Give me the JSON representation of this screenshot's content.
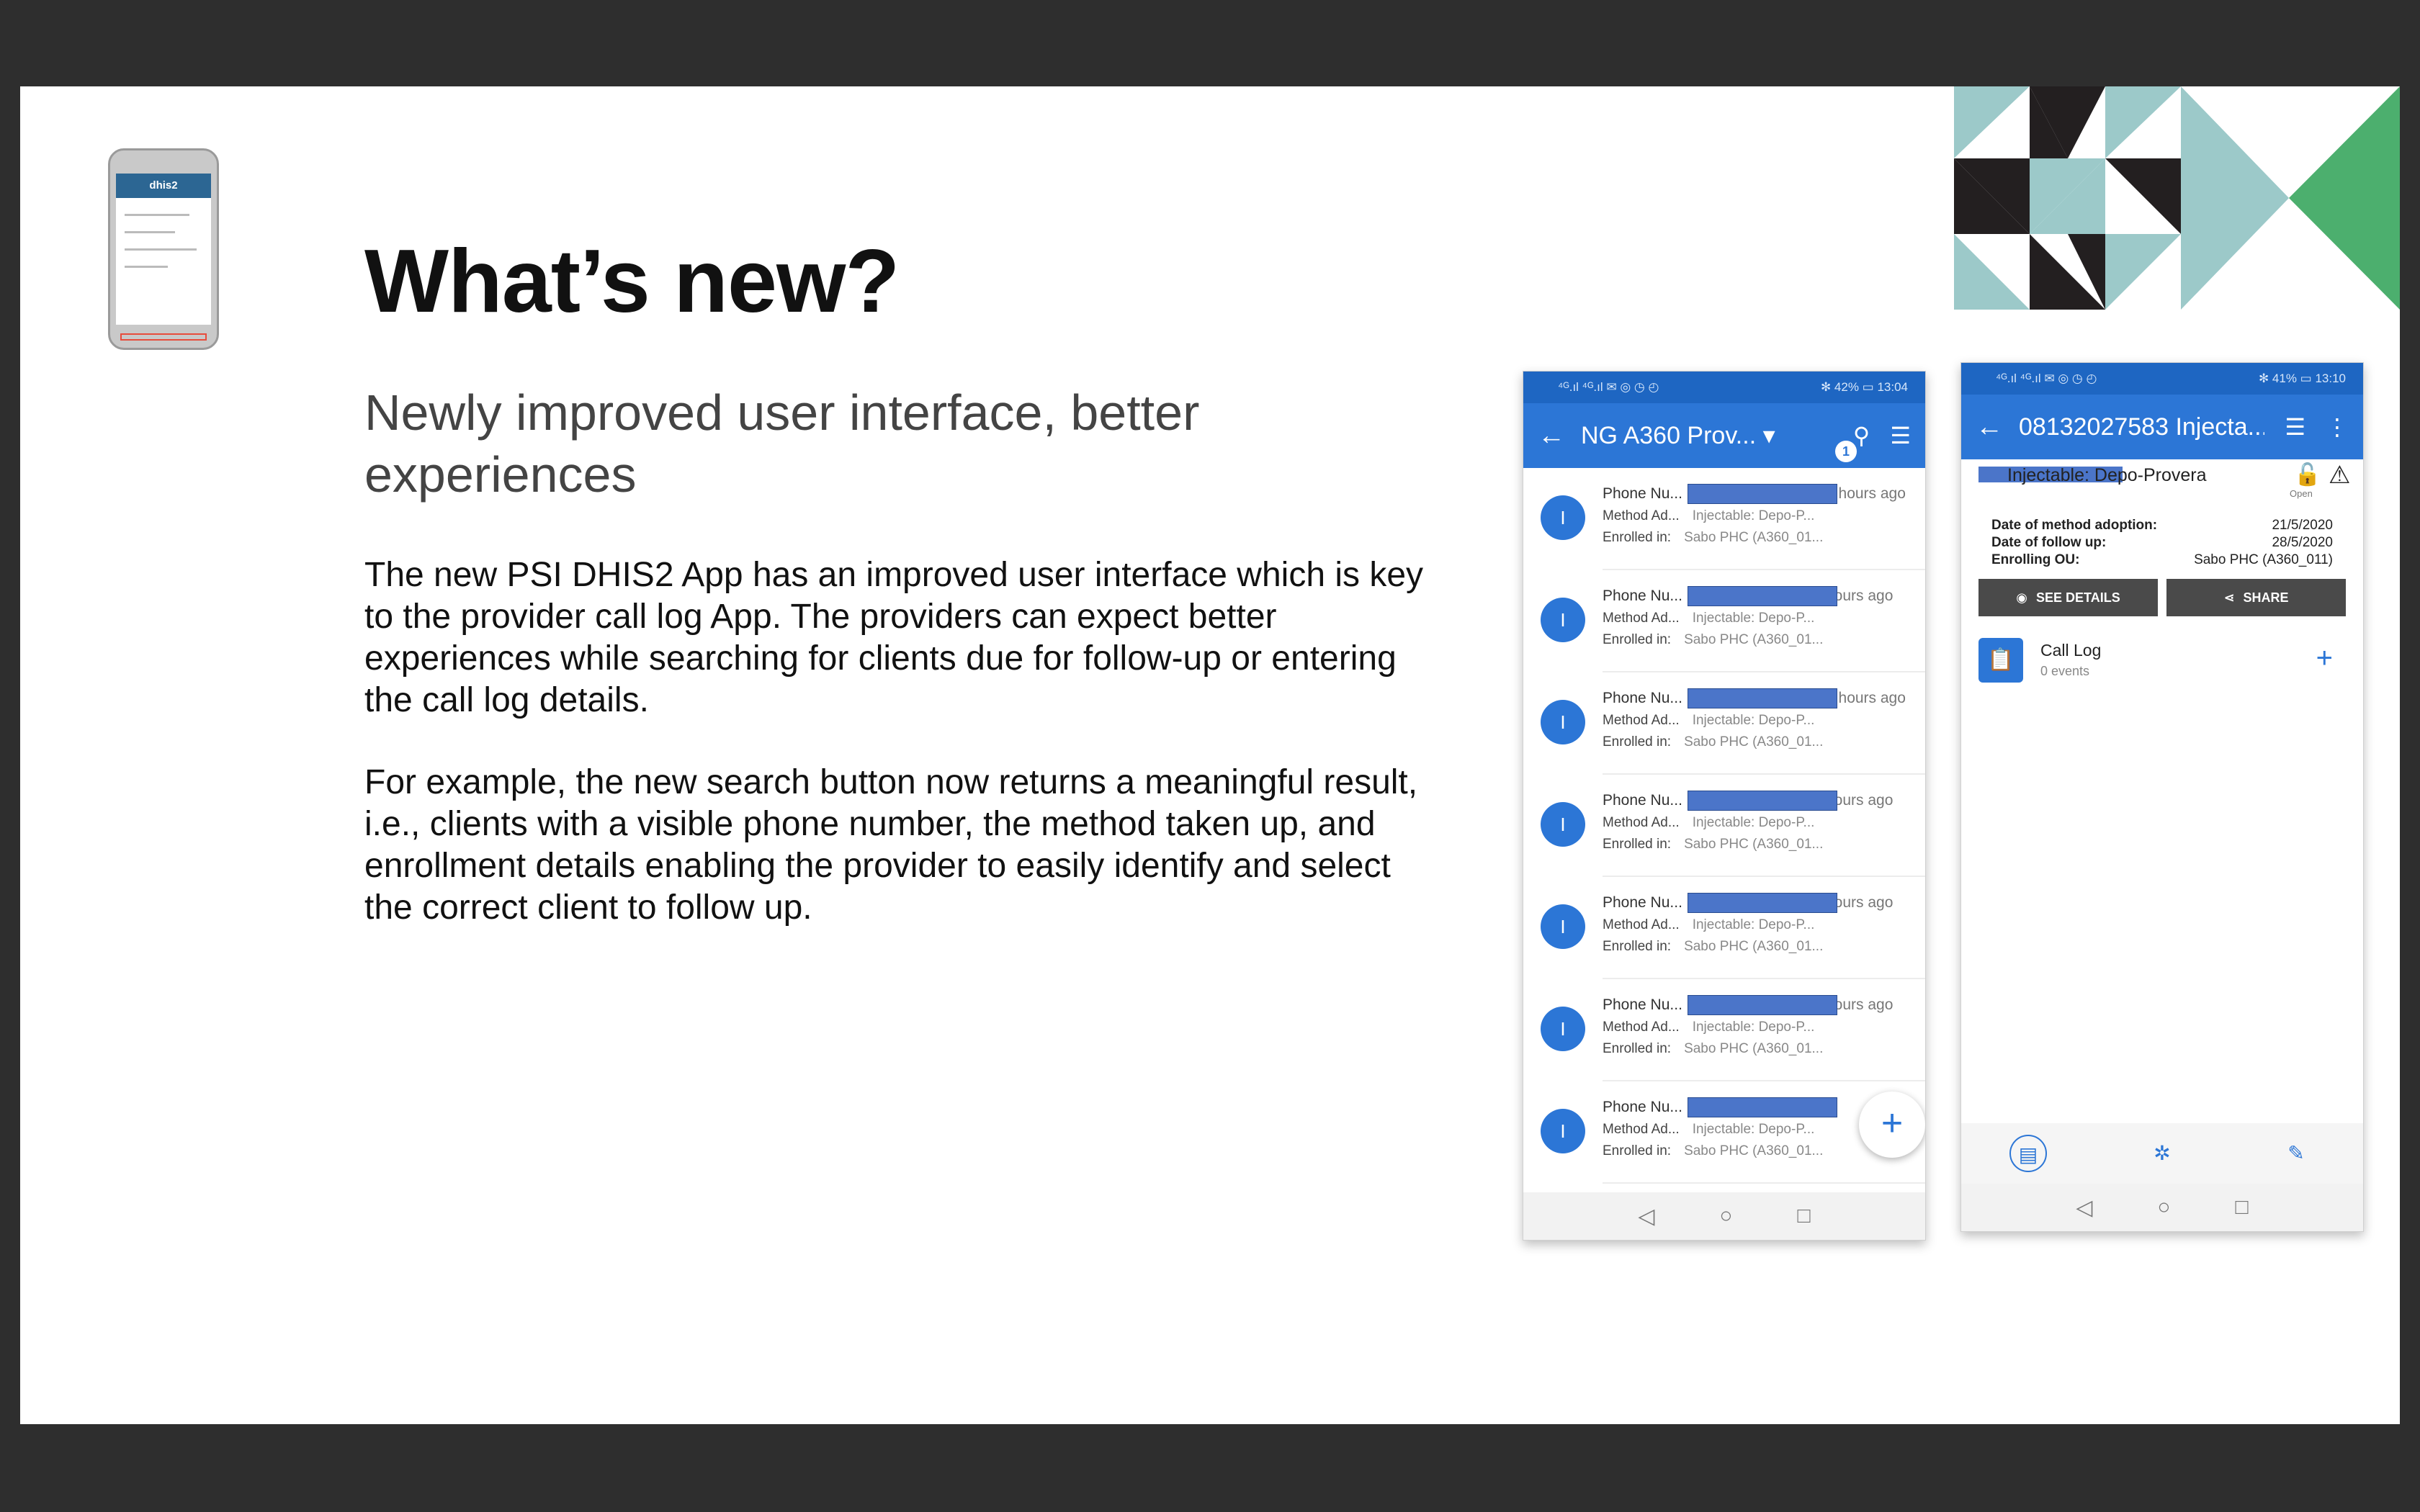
{
  "slide": {
    "title": "What’s new?",
    "subtitle": "Newly improved user interface, better experiences",
    "paragraph1": "The new PSI DHIS2 App has an improved user interface which is key to the provider call log App. The providers can expect better experiences while searching for clients due for follow-up or entering the call log details.",
    "paragraph2": "For example, the new search button now returns a meaningful result, i.e., clients with a visible phone number, the method taken up, and enrollment details enabling the provider to easily identify and select the correct client to follow up."
  },
  "thumbnail": {
    "brand": "dhis2"
  },
  "phone1": {
    "status_left": "⁴ᴳ.ıl ⁴ᴳ.ıl ✉ ◎ ◷ ◴",
    "status_right": "✻ 42% ▭ 13:04",
    "title": "NG A360 Prov...",
    "search_badge": "1",
    "rows": [
      {
        "avatar": "I",
        "label": "Phone Nu...",
        "time": "0 hours ago",
        "method_label": "Method Ad...",
        "method_value": "Injectable: Depo-P...",
        "enrolled_label": "Enrolled in:",
        "enrolled_value": "Sabo PHC (A360_01..."
      },
      {
        "avatar": "I",
        "label": "Phone Nu...",
        "time": "hours ago",
        "method_label": "Method Ad...",
        "method_value": "Injectable: Depo-P...",
        "enrolled_label": "Enrolled in:",
        "enrolled_value": "Sabo PHC (A360_01..."
      },
      {
        "avatar": "I",
        "label": "Phone Nu...",
        "time": "0 hours ago",
        "method_label": "Method Ad...",
        "method_value": "Injectable: Depo-P...",
        "enrolled_label": "Enrolled in:",
        "enrolled_value": "Sabo PHC (A360_01..."
      },
      {
        "avatar": "I",
        "label": "Phone Nu...",
        "time": "hours ago",
        "method_label": "Method Ad...",
        "method_value": "Injectable: Depo-P...",
        "enrolled_label": "Enrolled in:",
        "enrolled_value": "Sabo PHC (A360_01..."
      },
      {
        "avatar": "I",
        "label": "Phone Nu...",
        "time": "hours ago",
        "method_label": "Method Ad...",
        "method_value": "Injectable: Depo-P...",
        "enrolled_label": "Enrolled in:",
        "enrolled_value": "Sabo PHC (A360_01..."
      },
      {
        "avatar": "I",
        "label": "Phone Nu...",
        "time": "hours ago",
        "method_label": "Method Ad...",
        "method_value": "Injectable: Depo-P...",
        "enrolled_label": "Enrolled in:",
        "enrolled_value": "Sabo PHC (A360_01..."
      },
      {
        "avatar": "I",
        "label": "Phone Nu...",
        "time": "",
        "method_label": "Method Ad...",
        "method_value": "Injectable: Depo-P...",
        "enrolled_label": "Enrolled in:",
        "enrolled_value": "Sabo PHC (A360_01..."
      }
    ],
    "fab": "+"
  },
  "phone2": {
    "status_left": "⁴ᴳ.ıl ⁴ᴳ.ıl ✉ ◎ ◷ ◴",
    "status_right": "✻ 41% ▭ 13:10",
    "title": "08132027583 Injecta...",
    "enrollment_title": "Injectable: Depo-Provera",
    "open_label": "Open",
    "details": [
      {
        "key": "Date of method adoption:",
        "value": "21/5/2020"
      },
      {
        "key": "Date of follow up:",
        "value": "28/5/2020"
      },
      {
        "key": "Enrolling OU:",
        "value": "Sabo PHC (A360_011)"
      }
    ],
    "see_details": "SEE DETAILS",
    "share": "SHARE",
    "stage_title": "Call Log",
    "stage_events": "0 events"
  },
  "colors": {
    "brand_blue": "#2c76d6",
    "green": "#4caf6e",
    "teal": "#9cc9c9",
    "dark": "#231f20"
  }
}
